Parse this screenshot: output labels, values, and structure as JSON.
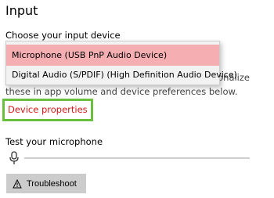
{
  "section": {
    "title": "Input"
  },
  "input_device": {
    "label": "Choose your input device",
    "options": [
      {
        "label": "Microphone (USB PnP Audio Device)",
        "highlighted": true
      },
      {
        "label": "Digital Audio (S/PDIF) (High Definition Audio Device)",
        "highlighted": false
      }
    ],
    "obscured_text_line1": "sonalize",
    "obscured_text_line2": "these in app volume and device preferences below."
  },
  "device_properties": {
    "label": "Device properties"
  },
  "test_microphone": {
    "label": "Test your microphone",
    "level": 0
  },
  "troubleshoot": {
    "label": "Troubleshoot",
    "icon": "warning-icon"
  },
  "colors": {
    "link": "#d41a1a",
    "highlight_border": "#6bbf3f",
    "selected_option": "#f5aeb2",
    "button_bg": "#cccccc"
  }
}
